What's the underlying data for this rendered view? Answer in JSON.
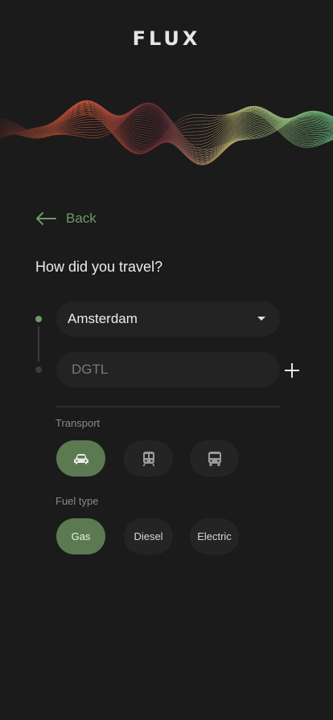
{
  "brand": {
    "logo": "FLUX"
  },
  "nav": {
    "back_label": "Back"
  },
  "form": {
    "question": "How did you travel?",
    "origin": {
      "value": "Amsterdam"
    },
    "destination": {
      "placeholder": "DGTL"
    },
    "transport": {
      "label": "Transport",
      "options": [
        {
          "icon": "car-icon",
          "selected": true
        },
        {
          "icon": "train-icon",
          "selected": false
        },
        {
          "icon": "bus-icon",
          "selected": false
        }
      ]
    },
    "fuel": {
      "label": "Fuel type",
      "options": [
        {
          "label": "Gas",
          "selected": true
        },
        {
          "label": "Diesel",
          "selected": false
        },
        {
          "label": "Electric",
          "selected": false
        }
      ]
    }
  },
  "colors": {
    "background": "#1b1b1b",
    "accent": "#5b7a52",
    "accent_text": "#6f9a66",
    "surface": "#242424"
  }
}
